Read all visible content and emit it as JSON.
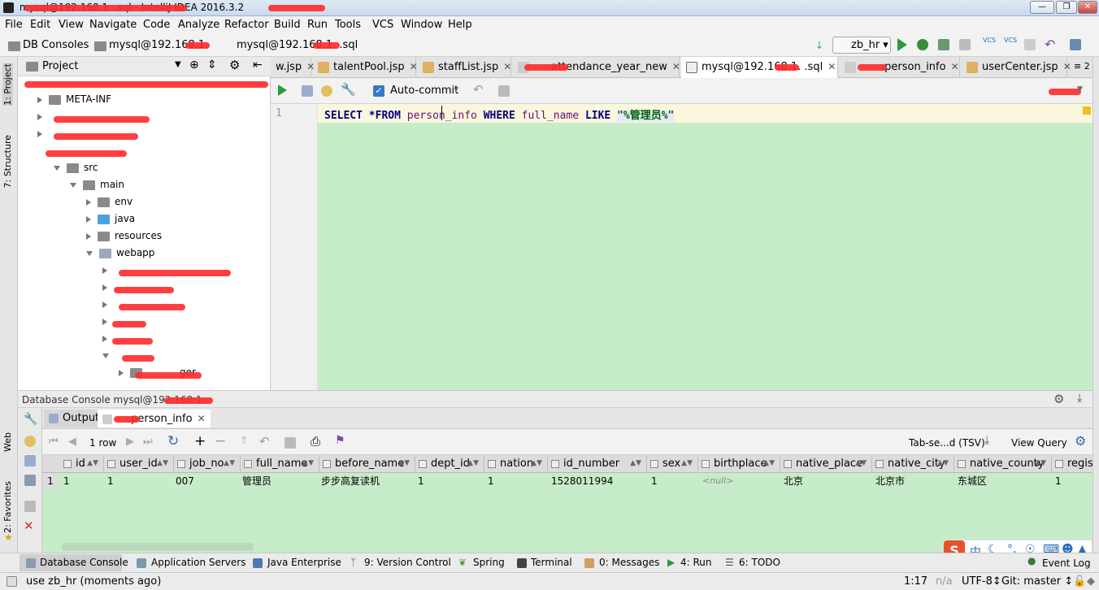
{
  "window": {
    "title": "mysql@192.168.1.  .sql - IntelliJ IDEA 2016.3.2",
    "controls": [
      "minimize",
      "restore",
      "close"
    ]
  },
  "menu": [
    "File",
    "Edit",
    "View",
    "Navigate",
    "Code",
    "Analyze",
    "Refactor",
    "Build",
    "Run",
    "Tools",
    "VCS",
    "Window",
    "Help"
  ],
  "breadcrumb": [
    "DB Consoles",
    "mysql@192.168.1.",
    "mysql@192.168.1.    .sql"
  ],
  "run_config": "zb_hr",
  "project_panel": {
    "title": "Project",
    "tree": [
      "META-INF",
      "src",
      "main",
      "env",
      "java",
      "resources",
      "webapp",
      "ger"
    ]
  },
  "left_tool_tabs": [
    "1: Project",
    "7: Structure",
    "Web",
    "2: Favorites"
  ],
  "file_tabs": [
    {
      "label": "w.jsp"
    },
    {
      "label": "talentPool.jsp"
    },
    {
      "label": "staffList.jsp"
    },
    {
      "label": "attendance_year_new"
    },
    {
      "label": "mysql@192.168.1.    .sql",
      "active": true
    },
    {
      "label": ".person_info"
    },
    {
      "label": "userCenter.jsp"
    },
    {
      "label": "≡ 2"
    }
  ],
  "editor_toolbar": {
    "auto_commit_label": "Auto-commit",
    "auto_commit_checked": true
  },
  "editor": {
    "line_number": "1",
    "tokens": {
      "select": "SELECT",
      "star_from": "*FROM",
      "table": "person_info",
      "where": "WHERE",
      "column": "full_name",
      "like": "LIKE",
      "pattern": "\"%管理员%\""
    }
  },
  "db_console": {
    "header": "Database Console mysql@192.168.1.",
    "tabs": [
      "Output",
      ".person_info"
    ],
    "row_count": "1 row",
    "format_label": "Tab-se...d (TSV)",
    "view_query_label": "View Query",
    "columns": [
      "id",
      "user_id",
      "job_no",
      "full_name",
      "before_name",
      "dept_id",
      "nation",
      "id_number",
      "sex",
      "birthplace",
      "native_place",
      "native_city",
      "native_county",
      "regis"
    ],
    "row_index": "1",
    "rows": [
      [
        "1",
        "1",
        "007",
        "管理员",
        "步步高复读机",
        "1",
        "1",
        "1528011994",
        "1",
        "<null>",
        "北京",
        "北京市",
        "东城区",
        "1"
      ]
    ]
  },
  "bottom_tool_tabs": [
    "Database Console",
    "Application Servers",
    "Java Enterprise",
    "9: Version Control",
    "Spring",
    "Terminal",
    "0: Messages",
    "4: Run",
    "6: TODO",
    "Event Log"
  ],
  "status": {
    "message": "use zb_hr (moments ago)",
    "position": "1:17",
    "na": "n/a",
    "encoding": "UTF-8↕",
    "git": "Git: master ↕"
  },
  "ime_bar": [
    "中"
  ],
  "colors": {
    "editor_bg": "#c7ecc9",
    "keyword": "#000080",
    "redaction": "#ff2a2a"
  }
}
